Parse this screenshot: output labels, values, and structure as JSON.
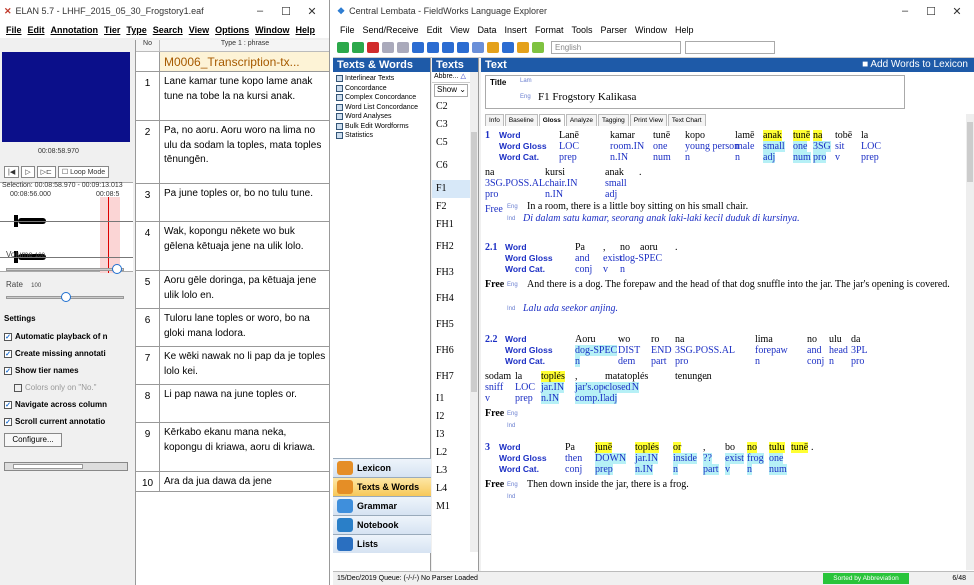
{
  "elan": {
    "title": "ELAN 5.7 - LHHF_2015_05_30_Frogstory1.eaf",
    "menus": [
      "File",
      "Edit",
      "Annotation",
      "Tier",
      "Type",
      "Search",
      "View",
      "Options",
      "Window",
      "Help"
    ],
    "media_time": "00:08:58.970",
    "selection_label": "Selection: 00:08:58.970 - 00:09:13.013",
    "wave_t1": "00:08:56.000",
    "wave_t2": "00:08:5",
    "mode_label": "Loop Mode",
    "volume_label": "Volume",
    "volume_value": "100",
    "volume_level": 0.97,
    "rate_label": "Rate",
    "rate_value": "100",
    "rate_level": 0.5,
    "settings_title": "Settings",
    "settings": [
      {
        "label": "Automatic playback of n",
        "checked": true,
        "disabled": false
      },
      {
        "label": "Create missing annotati",
        "checked": true,
        "disabled": false
      },
      {
        "label": "Show tier names",
        "checked": true,
        "disabled": false
      },
      {
        "label": "Colors only on \"No.\"",
        "checked": false,
        "disabled": true
      },
      {
        "label": "Navigate across column",
        "checked": true,
        "disabled": false
      },
      {
        "label": "Scroll current annotatio",
        "checked": true,
        "disabled": false
      }
    ],
    "configure": "Configure...",
    "grid_head_no": "No",
    "grid_head_type": "Type 1 : phrase",
    "rows": [
      {
        "n": "",
        "t": "M0006_Transcription-tx...",
        "sel": true
      },
      {
        "n": "1",
        "t": "Lane kamar tune kopo lame anak tune na tobe la na kursi anak."
      },
      {
        "n": "2",
        "t": "Pa, no aoru. Aoru woro na lima no ulu da sodam la toples, mata toples tēnungēn."
      },
      {
        "n": "3",
        "t": "Pa june toples or, bo no tulu tune."
      },
      {
        "n": "4",
        "t": "Wak, kopongu nēkete wo buk gēlena kētuaja jene na ulik lolo."
      },
      {
        "n": "5",
        "t": "Aoru gēle doringa, pa kētuaja jene ulik lolo en."
      },
      {
        "n": "6",
        "t": "Tuloru lane toples or woro, bo na gloki mana lodora."
      },
      {
        "n": "7",
        "t": "Ke wēki nawak no li pap da je toples lolo kei."
      },
      {
        "n": "8",
        "t": "Li pap nawa na june toples or."
      },
      {
        "n": "9",
        "t": "Kērkabo ekanu mana neka, kopongu di kriawa, aoru di kriawa."
      },
      {
        "n": "10",
        "t": "Ara da jua dawa da jene"
      }
    ]
  },
  "flex": {
    "title": "Central Lembata - FieldWorks Language Explorer",
    "menus": [
      "File",
      "Send/Receive",
      "Edit",
      "View",
      "Data",
      "Insert",
      "Format",
      "Tools",
      "Parser",
      "Window",
      "Help"
    ],
    "writing_system": "English",
    "sidebar_title": "Texts & Words",
    "sidebar_items": [
      "Interlinear Texts",
      "Concordance",
      "Complex Concordance",
      "Word List Concordance",
      "Word Analyses",
      "Bulk Edit Wordforms",
      "Statistics"
    ],
    "nav": [
      "Lexicon",
      "Texts & Words",
      "Grammar",
      "Notebook",
      "Lists"
    ],
    "texts_title": "Texts",
    "texts_col": "Abbre...",
    "texts_show": "Show",
    "texts": [
      "C2",
      "C3",
      "C5",
      "C6",
      "F1",
      "F2",
      "FH1",
      "FH2",
      "FH3",
      "FH4",
      "FH5",
      "FH6",
      "FH7",
      "I1",
      "I2",
      "I3",
      "L2",
      "L3",
      "L4",
      "M1"
    ],
    "text_title": "Text",
    "add_words": "Add Words to Lexicon",
    "title_label": "Title",
    "title_ws": "Lam",
    "eng_ws": "Eng",
    "title_value": "F1 Frogstory Kalikasa",
    "tabs": [
      "Info",
      "Baseline",
      "Gloss",
      "Analyze",
      "Tagging",
      "Print View",
      "Text Chart"
    ],
    "status_left": "15/Dec/2019  Queue: (-/-/-) No Parser Loaded",
    "status_sorted": "Sorted by Abbreviation",
    "status_count": "6/48",
    "lines": {
      "word": "Word",
      "gloss": "Word Gloss",
      "cat": "Word Cat.",
      "free": "Free",
      "eng": "Eng",
      "ind": "Ind",
      "s1_n": "1",
      "s1_words": [
        "Lanē",
        "kamar",
        "tunē",
        "kopo",
        "lamē",
        "anak",
        "tunē",
        "na",
        "tobē",
        "la"
      ],
      "s1_gloss": [
        "LOC",
        "room.IN",
        "one",
        "young person",
        "male",
        "small",
        "one",
        "3SG",
        "sit",
        "LOC"
      ],
      "s1_cat": [
        "prep",
        "n.IN",
        "num",
        "n",
        "n",
        "adj",
        "num",
        "pro",
        "v",
        "prep"
      ],
      "s1b_words": [
        "na",
        "kursi",
        "anak",
        "."
      ],
      "s1b_gloss": [
        "3SG.POSS.AL",
        "chair.IN",
        "small"
      ],
      "s1b_cat": [
        "pro",
        "n.IN",
        "adj"
      ],
      "s1_free": "In a room, there is a little boy sitting on his small chair.",
      "s1_ind": "Di dalam satu kamar, seorang anak laki-laki kecil duduk di kursinya.",
      "s2_n": "2.1",
      "s2_words": [
        "Pa",
        ",",
        "no",
        "aoru",
        "."
      ],
      "s2_gloss": [
        "and",
        "exist",
        "dog-SPEC"
      ],
      "s2_cat": [
        "conj",
        "v",
        "n"
      ],
      "s2_free": "And there is a dog. The forepaw and the head of that dog snuffle into the jar. The jar's opening is covered.",
      "s2_ind": "Lalu ada seekor anjing.",
      "s22_n": "2.2",
      "s22_words": [
        "Aoru",
        "wo",
        "ro",
        "na",
        "lima",
        "no",
        "ulu",
        "da"
      ],
      "s22_gloss": [
        "dog-SPEC",
        "DIST",
        "END",
        "3SG.POSS.AL",
        "forepaw",
        "and",
        "head",
        "3PL"
      ],
      "s22_cat": [
        "n",
        "dem",
        "part",
        "pro",
        "n",
        "conj",
        "n",
        "pro"
      ],
      "s22b_words": [
        "sodam",
        "la",
        "toplés",
        ",",
        "matatoplés",
        "tenungen",
        "."
      ],
      "s22b_gloss": [
        "sniff",
        "LOC",
        "jar.IN",
        "jar's.opening.IN",
        "closed"
      ],
      "s22b_cat": [
        "v",
        "prep",
        "n.IN",
        "comp.IN",
        "adj"
      ],
      "s3_n": "3",
      "s3_words": [
        "Pa",
        "junē",
        "toplés",
        "or",
        ",",
        "bo",
        "no",
        "tulu",
        "tunē",
        "."
      ],
      "s3_gloss": [
        "then",
        "DOWN",
        "jar.IN",
        "inside",
        "??",
        "exist",
        "frog",
        "one"
      ],
      "s3_cat": [
        "conj",
        "prep",
        "n.IN",
        "n",
        "part",
        "v",
        "n",
        "num"
      ],
      "s3_free": "Then down inside the jar, there is a frog."
    }
  }
}
